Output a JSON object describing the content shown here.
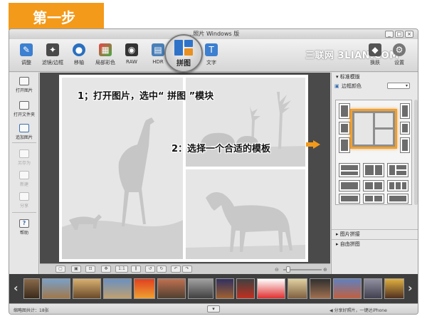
{
  "step_badge": "第一步",
  "window": {
    "title": "...照片 Windows 版",
    "controls": [
      "_",
      "□",
      "×"
    ]
  },
  "watermark": "三联网 3LIAN.COM",
  "toolbar": {
    "tools": [
      {
        "label": "调整",
        "icon": "adjust-icon"
      },
      {
        "label": "滤镜/边框",
        "icon": "filter-icon"
      },
      {
        "label": "移轴",
        "icon": "tilt-shift-icon"
      },
      {
        "label": "局部彩色",
        "icon": "color-splash-icon"
      },
      {
        "label": "RAW",
        "icon": "raw-icon"
      },
      {
        "label": "HDR",
        "icon": "hdr-icon"
      },
      {
        "label": "文字",
        "icon": "text-icon"
      }
    ],
    "puzzle_label": "拼图",
    "right_tools": [
      {
        "label": "换肤",
        "icon": "skin-icon"
      },
      {
        "label": "设置",
        "icon": "gear-icon"
      }
    ]
  },
  "left_panel": {
    "items": [
      {
        "label": "打开图片",
        "enabled": true
      },
      {
        "label": "打开文件夹",
        "enabled": true
      },
      {
        "label": "追加图片",
        "enabled": true
      },
      {
        "label": "另存为",
        "enabled": false
      },
      {
        "label": "新建",
        "enabled": false
      },
      {
        "label": "分享",
        "enabled": false
      },
      {
        "label": "帮助",
        "enabled": true
      }
    ]
  },
  "annotations": {
    "step1": "1；打开图片，选中“ 拼图 ”模块",
    "step2": "2：选择一个合适的模板"
  },
  "bottom_tools": {
    "zoom_label": "1:1"
  },
  "right_panel": {
    "section1": "标准模版",
    "border_color_label": "边框颜色",
    "section2": "图片拼接",
    "section3": "自由拼图"
  },
  "statusbar": {
    "left": "缩略图共计：18张",
    "right": "分享好照片，一键达iPhone"
  },
  "colors": {
    "accent": "#f39a1a",
    "puzzle_blue": "#2f73c9"
  }
}
